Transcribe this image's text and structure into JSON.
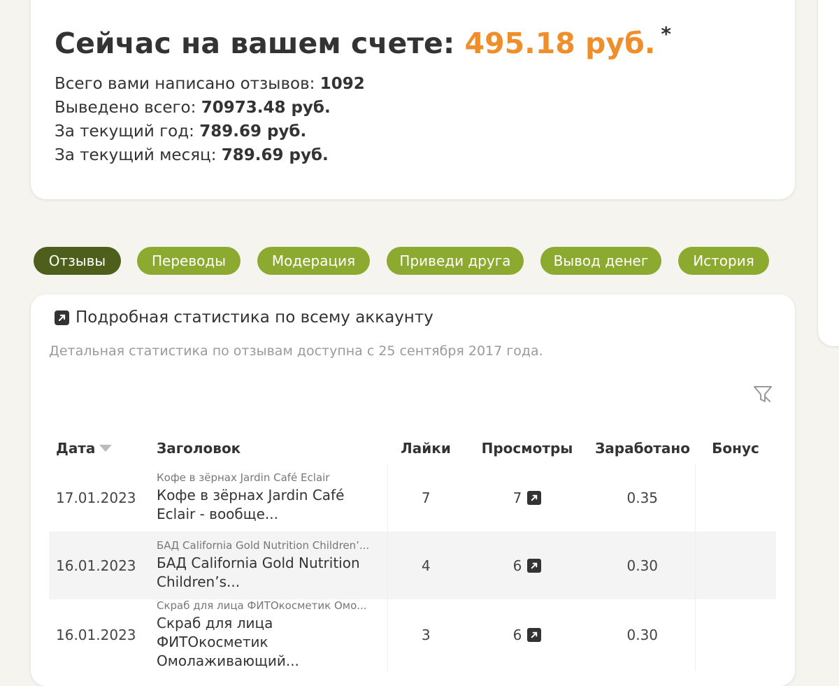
{
  "balance": {
    "label": "Сейчас на вашем счете:",
    "amount": "495.18 руб.",
    "asterisk": "*"
  },
  "stats": [
    {
      "label": "Всего вами написано отзывов:",
      "value": "1092"
    },
    {
      "label": "Выведено всего:",
      "value": "70973.48 руб."
    },
    {
      "label": "За текущий год:",
      "value": "789.69 руб."
    },
    {
      "label": "За текущий месяц:",
      "value": "789.69 руб."
    }
  ],
  "tabs": [
    {
      "label": "Отзывы",
      "active": true
    },
    {
      "label": "Переводы"
    },
    {
      "label": "Модерация"
    },
    {
      "label": "Приведи друга"
    },
    {
      "label": "Вывод денег"
    },
    {
      "label": "История"
    }
  ],
  "details": {
    "link_label": "Подробная статистика по всему аккаунту",
    "note": "Детальная статистика по отзывам доступна с 25 сентября 2017 года.",
    "link_icon": "external-link-icon",
    "filter_icon": "filter-icon"
  },
  "table": {
    "headers": {
      "date": "Дата",
      "title": "Заголовок",
      "likes": "Лайки",
      "views": "Просмотры",
      "earned": "Заработано",
      "bonus": "Бонус"
    },
    "rows": [
      {
        "date": "17.01.2023",
        "product": "Кофе в зёрнах Jardin Café Eclair",
        "title": "Кофе в зёрнах Jardin Café Eclair - вообще...",
        "likes": "7",
        "views": "7",
        "earned": "0.35",
        "bonus": ""
      },
      {
        "date": "16.01.2023",
        "product": "БАД California Gold Nutrition Children’...",
        "title": "БАД California Gold Nutrition Children’s...",
        "likes": "4",
        "views": "6",
        "earned": "0.30",
        "bonus": ""
      },
      {
        "date": "16.01.2023",
        "product": "Скраб для лица ФИТОкосметик Омо...",
        "title": "Скраб для лица ФИТОкосметик Омолаживающий...",
        "likes": "3",
        "views": "6",
        "earned": "0.30",
        "bonus": ""
      }
    ]
  },
  "colors": {
    "accent_orange": "#ef8f2b",
    "tab_green": "#8daa30",
    "tab_active": "#4e5f1c"
  }
}
